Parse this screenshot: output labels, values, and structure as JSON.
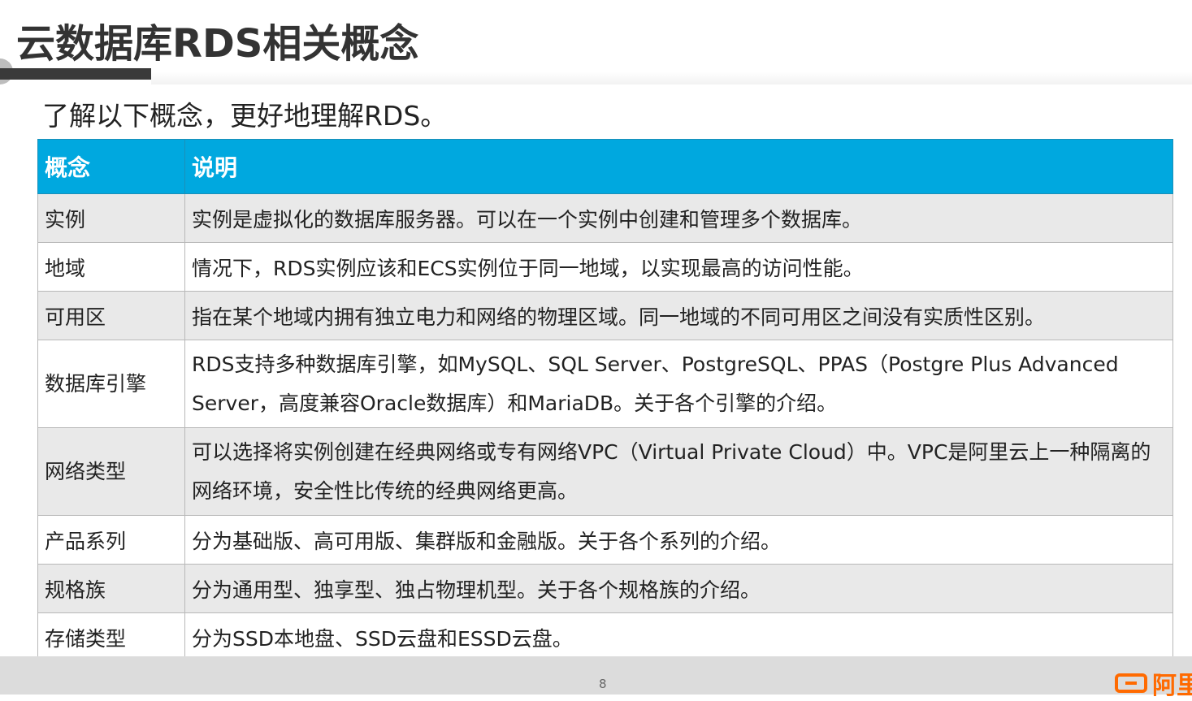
{
  "header": {
    "title": "云数据库RDS相关概念",
    "subtitle": "了解以下概念，更好地理解RDS。"
  },
  "table": {
    "columns": [
      "概念",
      "说明"
    ],
    "rows": [
      {
        "concept": "实例",
        "desc": "实例是虚拟化的数据库服务器。可以在一个实例中创建和管理多个数据库。"
      },
      {
        "concept": "地域",
        "desc": "情况下，RDS实例应该和ECS实例位于同一地域，以实现最高的访问性能。"
      },
      {
        "concept": "可用区",
        "desc": "指在某个地域内拥有独立电力和网络的物理区域。同一地域的不同可用区之间没有实质性区别。"
      },
      {
        "concept": "数据库引擎",
        "desc": "RDS支持多种数据库引擎，如MySQL、SQL Server、PostgreSQL、PPAS（Postgre Plus Advanced Server，高度兼容Oracle数据库）和MariaDB。关于各个引擎的介绍。"
      },
      {
        "concept": "网络类型",
        "desc": "可以选择将实例创建在经典网络或专有网络VPC（Virtual Private Cloud）中。VPC是阿里云上一种隔离的网络环境，安全性比传统的经典网络更高。"
      },
      {
        "concept": "产品系列",
        "desc": "分为基础版、高可用版、集群版和金融版。关于各个系列的介绍。"
      },
      {
        "concept": "规格族",
        "desc": "分为通用型、独享型、独占物理机型。关于各个规格族的介绍。"
      },
      {
        "concept": "存储类型",
        "desc": "分为SSD本地盘、SSD云盘和ESSD云盘。"
      }
    ]
  },
  "footer": {
    "page_number": "8",
    "logo_text": "阿里",
    "logo_icon": "aliyun-logo-icon"
  },
  "colors": {
    "header_bg": "#00a8df",
    "alt_row_bg": "#e9e9e9",
    "logo": "#ff6a00"
  }
}
